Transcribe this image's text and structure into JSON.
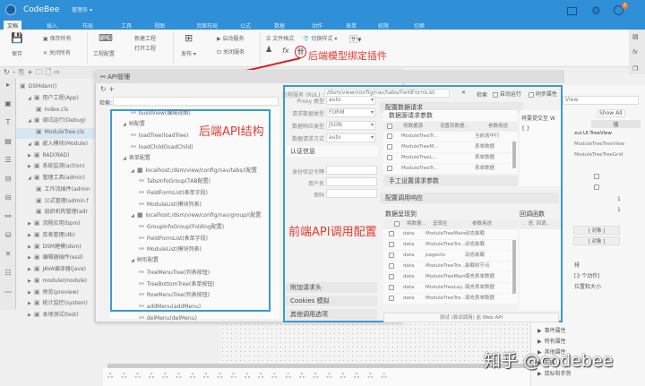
{
  "app": {
    "name": "CodeBee",
    "user_menu": "管理员",
    "notification_count": "2"
  },
  "tabs": [
    "文档",
    "插入",
    "布局",
    "工具",
    "视图",
    "页面布局",
    "公式",
    "数据",
    "动作",
    "表单",
    "权限",
    "切换"
  ],
  "ribbon": {
    "save": "保存",
    "save_all": "保存所有",
    "close_all": "关闭所有",
    "project_config": "工程配置",
    "new_project": "新建工程",
    "open_project": "打开工程",
    "publish": "发布",
    "start_service": "启动服务",
    "stop_service": "关闭服务",
    "file_format": "文件格式",
    "switch_style": "切换样式"
  },
  "annotations": {
    "plugin": "后端模型绑定插件",
    "backend_api": "后端API结构",
    "frontend_api": "前端API调用配置"
  },
  "project_tree": [
    {
      "label": "DSMdam()",
      "level": 0,
      "icon": "bank-icon"
    },
    {
      "label": "用户工程(App)",
      "level": 1,
      "icon": "users-icon"
    },
    {
      "label": "Index.cls",
      "level": 2,
      "icon": "file-icon"
    },
    {
      "label": "调试运行(Debug)",
      "level": 1,
      "icon": "bug-icon"
    },
    {
      "label": "ModuleTree.cls",
      "level": 2,
      "icon": "file-icon",
      "selected": true
    },
    {
      "label": "嵌入模块(Module)",
      "level": 1,
      "icon": "module-icon"
    },
    {
      "label": "RAD(RAD)",
      "level": 1,
      "icon": "folder-icon"
    },
    {
      "label": "系统监测(action)",
      "level": 1,
      "icon": "monitor-icon"
    },
    {
      "label": "管理工具(admin)",
      "level": 1,
      "icon": "gear-icon"
    },
    {
      "label": "工作流插件(admin",
      "level": 2,
      "icon": "workflow-icon"
    },
    {
      "label": "公式管理(admin.f",
      "level": 2,
      "icon": "fx-icon"
    },
    {
      "label": "组织机构管理(adr",
      "level": 2,
      "icon": "users-icon"
    },
    {
      "label": "流程应用(bpm)",
      "level": 1,
      "icon": "flow-icon"
    },
    {
      "label": "库表管理(db)",
      "level": 1,
      "icon": "table-icon"
    },
    {
      "label": "DSM建模(dsm)",
      "level": 1,
      "icon": "grid-icon"
    },
    {
      "label": "编辑器插件(esd)",
      "level": 1,
      "icon": "gear-icon"
    },
    {
      "label": "JAVA编译器(java)",
      "level": 1,
      "icon": "monitor-icon"
    },
    {
      "label": "module(module)",
      "level": 1,
      "icon": "folder-icon"
    },
    {
      "label": "预览(preview)",
      "level": 1,
      "icon": "bug-icon"
    },
    {
      "label": "统计监控(system)",
      "level": 1,
      "icon": "chart-icon"
    },
    {
      "label": "本地测试(test)",
      "level": 1,
      "icon": "gear-icon"
    }
  ],
  "api_dialog": {
    "title": "API管理",
    "search_label": "检索:",
    "tree": [
      {
        "label": "buildView(编辑视图)",
        "level": 2
      },
      {
        "label": "树配置",
        "level": 1,
        "group": true
      },
      {
        "label": "loadTree(loadTree)",
        "level": 2
      },
      {
        "label": "loadChild(loadChild)",
        "level": 2
      },
      {
        "label": "表单配置",
        "level": 1,
        "group": true
      },
      {
        "label": "localhost:/dsm/view/config/nav/tabs/(配置",
        "level": 2,
        "group": true
      },
      {
        "label": "TabsInfoGroup(TAB配置)",
        "level": 3
      },
      {
        "label": "FieldFormList(表单字段)",
        "level": 3
      },
      {
        "label": "ModuleList(模块列表)",
        "level": 3
      },
      {
        "label": "localhost:/dsm/view/config/nav/group/(配置",
        "level": 2,
        "group": true
      },
      {
        "label": "GroupInfoGroup(Folding配置)",
        "level": 3
      },
      {
        "label": "FieldFormList(表单字段)",
        "level": 3
      },
      {
        "label": "ModuleList(模块列表)",
        "level": 3
      },
      {
        "label": "树形配置",
        "level": 2,
        "group": true
      },
      {
        "label": "TreeMenuTree(列表按钮)",
        "level": 3
      },
      {
        "label": "TreeBottomTree(表单按钮)",
        "level": 3
      },
      {
        "label": "RowMenuTree(列表按钮)",
        "level": 3
      },
      {
        "label": "addMenu(addMenu)",
        "level": 3
      },
      {
        "label": "delMenu(delMenu)",
        "level": 3
      }
    ]
  },
  "api_config": {
    "url_label": "远程服务 (RUL) :",
    "url": "/dsm/view/config/nav/tabs/FieldFormList",
    "search": "检索",
    "auto_run": "自动运行",
    "sync_props": "同步属性",
    "options": [
      {
        "label": "Proxy 类型",
        "value": "auto"
      },
      {
        "label": "请求数据类型",
        "value": "FORM"
      },
      {
        "label": "数据响应类型",
        "value": "JSON"
      },
      {
        "label": "数据请求方式",
        "value": "auto"
      }
    ],
    "auth_title": "认证信息",
    "auth_fields": [
      "身份验证令牌",
      "用户名",
      "密码"
    ],
    "bottom_sections": [
      "附加请求头",
      "Cookies 模拟",
      "其他调用选项"
    ],
    "request_title": "配置数据请求",
    "request_params_title": "数据源请求参数",
    "request_headers": [
      "将数据源",
      "设置到数据...",
      "参数用途"
    ],
    "request_rows": [
      [
        "ModuleTreeTr...",
        "当前选中行"
      ],
      [
        "ModuleTreeM...",
        "表单数据"
      ],
      [
        "ModuleTreeL...",
        "表单数据"
      ],
      [
        "ModuleTreeTr...",
        "表单数据"
      ]
    ],
    "manual_params": "手工设置请求参数",
    "submit_title": "将要提交至 W",
    "submit_value": "{ }",
    "response_title": "配置调用响应",
    "render_title": "数据呈现到",
    "response_headers": [
      "将数据...",
      "呈现在",
      "参数用途"
    ],
    "response_rows": [
      [
        "data",
        "ModuleTreeMain",
        "动态装载"
      ],
      [
        "data",
        "ModuleTreeTre...",
        "动态装载"
      ],
      [
        "data",
        "pagectx",
        "动态装载"
      ],
      [
        "data",
        "ModuleTreeTre...",
        "装载树节点"
      ],
      [
        "data",
        "ModuleTreeMain",
        "填充表单数据"
      ],
      [
        "data",
        "ModuleTreeLay...",
        "填充表单数据"
      ],
      [
        "data",
        "ModuleTreeTre...",
        "填充表单数据"
      ]
    ],
    "callback_title": "回调函数",
    "callback_headers": [
      "..",
      "语, 回调..."
    ],
    "test_button": "测试 (尝试调用) 此 Web API"
  },
  "props": {
    "show_all": "Show All",
    "value_header": "值",
    "filter": "View",
    "values": [
      "xui.UI.TreeView",
      "ModuleTreeTreeView",
      "ModuleTreeTreeGrid"
    ],
    "nums": [
      "1",
      "1"
    ],
    "objects": [
      "[ 对象 ]",
      "[ 对象 ]"
    ],
    "misc": [
      "排",
      "[3 个动作]",
      "位置和大小"
    ],
    "sections": [
      "事件属性",
      "特有属性",
      "其他属性",
      "布局",
      "鼠标和手势"
    ]
  },
  "watermark": "知乎 @codebee"
}
